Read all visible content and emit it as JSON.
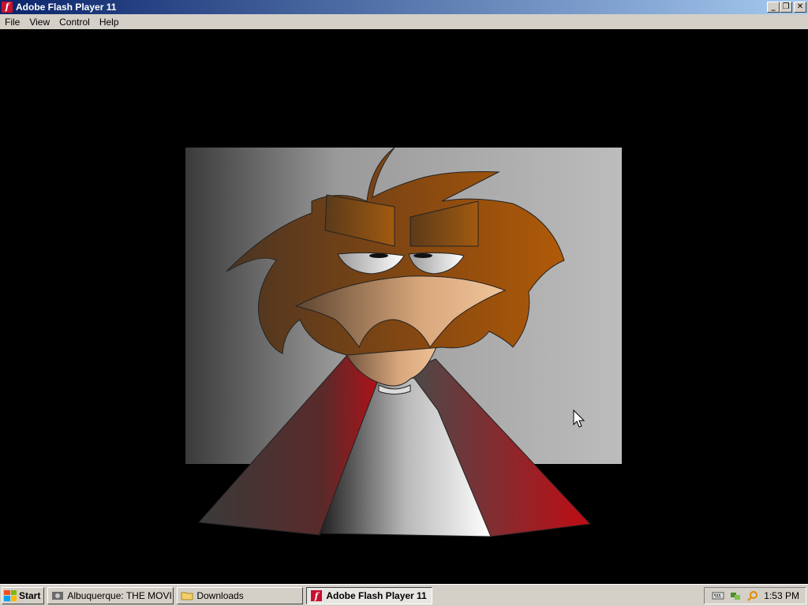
{
  "window": {
    "title": "Adobe Flash Player 11",
    "app_icon_glyph": "f",
    "controls": {
      "minimize": "_",
      "restore": "❐",
      "close": "✕"
    }
  },
  "menu": {
    "items": [
      "File",
      "View",
      "Control",
      "Help"
    ]
  },
  "stage": {
    "background": "#000000",
    "movie_colors": {
      "hair": "#8a4a10",
      "skin": "#e8b88a",
      "coat": "#a00c14",
      "shirt": "#ffffff"
    }
  },
  "taskbar": {
    "start_label": "Start",
    "tasks": [
      {
        "label": "Albuquerque: THE MOVI...",
        "icon": "movie-icon",
        "active": false
      },
      {
        "label": "Downloads",
        "icon": "folder-icon",
        "active": false
      },
      {
        "label": "Adobe Flash Player 11",
        "icon": "flash-icon",
        "active": true
      }
    ],
    "tray": {
      "clock": "1:53 PM",
      "icons": [
        "keyboard-icon",
        "network-icon",
        "search-icon"
      ]
    }
  }
}
